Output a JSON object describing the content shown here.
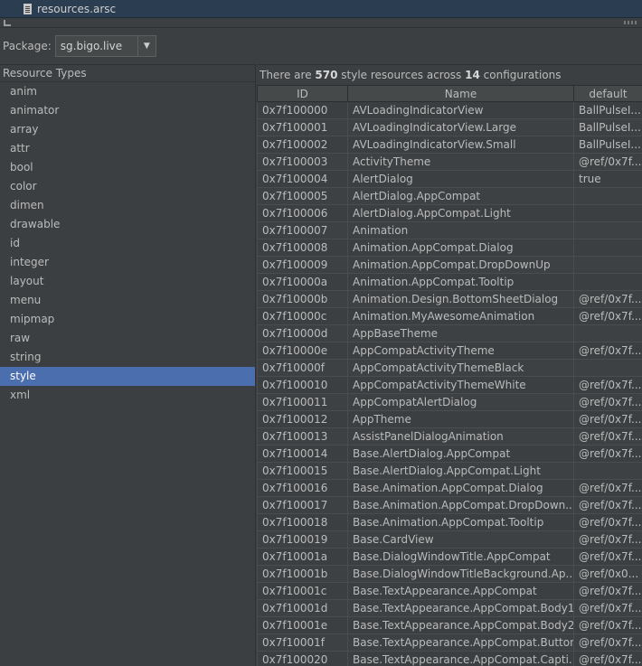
{
  "tab": {
    "title": "resources.arsc",
    "icon": "file-icon"
  },
  "package": {
    "label": "Package:",
    "value": "sg.bigo.live"
  },
  "left": {
    "header": "Resource Types",
    "items": [
      "anim",
      "animator",
      "array",
      "attr",
      "bool",
      "color",
      "dimen",
      "drawable",
      "id",
      "integer",
      "layout",
      "menu",
      "mipmap",
      "raw",
      "string",
      "style",
      "xml"
    ],
    "selected": "style"
  },
  "summary": {
    "prefix": "There are ",
    "count": "570",
    "middle": " style resources across ",
    "configs": "14",
    "suffix": " configurations"
  },
  "table": {
    "columns": [
      "ID",
      "Name",
      "default"
    ],
    "rows": [
      [
        "0x7f100000",
        "AVLoadingIndicatorView",
        "BallPulseI..."
      ],
      [
        "0x7f100001",
        "AVLoadingIndicatorView.Large",
        "BallPulseI..."
      ],
      [
        "0x7f100002",
        "AVLoadingIndicatorView.Small",
        "BallPulseI..."
      ],
      [
        "0x7f100003",
        "ActivityTheme",
        "@ref/0x7f..."
      ],
      [
        "0x7f100004",
        "AlertDialog",
        "true"
      ],
      [
        "0x7f100005",
        "AlertDialog.AppCompat",
        ""
      ],
      [
        "0x7f100006",
        "AlertDialog.AppCompat.Light",
        ""
      ],
      [
        "0x7f100007",
        "Animation",
        ""
      ],
      [
        "0x7f100008",
        "Animation.AppCompat.Dialog",
        ""
      ],
      [
        "0x7f100009",
        "Animation.AppCompat.DropDownUp",
        ""
      ],
      [
        "0x7f10000a",
        "Animation.AppCompat.Tooltip",
        ""
      ],
      [
        "0x7f10000b",
        "Animation.Design.BottomSheetDialog",
        "@ref/0x7f..."
      ],
      [
        "0x7f10000c",
        "Animation.MyAwesomeAnimation",
        "@ref/0x7f..."
      ],
      [
        "0x7f10000d",
        "AppBaseTheme",
        ""
      ],
      [
        "0x7f10000e",
        "AppCompatActivityTheme",
        "@ref/0x7f..."
      ],
      [
        "0x7f10000f",
        "AppCompatActivityThemeBlack",
        ""
      ],
      [
        "0x7f100010",
        "AppCompatActivityThemeWhite",
        "@ref/0x7f..."
      ],
      [
        "0x7f100011",
        "AppCompatAlertDialog",
        "@ref/0x7f..."
      ],
      [
        "0x7f100012",
        "AppTheme",
        "@ref/0x7f..."
      ],
      [
        "0x7f100013",
        "AssistPanelDialogAnimation",
        "@ref/0x7f..."
      ],
      [
        "0x7f100014",
        "Base.AlertDialog.AppCompat",
        "@ref/0x7f..."
      ],
      [
        "0x7f100015",
        "Base.AlertDialog.AppCompat.Light",
        ""
      ],
      [
        "0x7f100016",
        "Base.Animation.AppCompat.Dialog",
        "@ref/0x7f..."
      ],
      [
        "0x7f100017",
        "Base.Animation.AppCompat.DropDown...",
        "@ref/0x7f..."
      ],
      [
        "0x7f100018",
        "Base.Animation.AppCompat.Tooltip",
        "@ref/0x7f..."
      ],
      [
        "0x7f100019",
        "Base.CardView",
        "@ref/0x7f..."
      ],
      [
        "0x7f10001a",
        "Base.DialogWindowTitle.AppCompat",
        "@ref/0x7f..."
      ],
      [
        "0x7f10001b",
        "Base.DialogWindowTitleBackground.Ap...",
        "@ref/0x0..."
      ],
      [
        "0x7f10001c",
        "Base.TextAppearance.AppCompat",
        "@ref/0x7f..."
      ],
      [
        "0x7f10001d",
        "Base.TextAppearance.AppCompat.Body1",
        "@ref/0x7f..."
      ],
      [
        "0x7f10001e",
        "Base.TextAppearance.AppCompat.Body2",
        "@ref/0x7f..."
      ],
      [
        "0x7f10001f",
        "Base.TextAppearance.AppCompat.Button",
        "@ref/0x7f..."
      ],
      [
        "0x7f100020",
        "Base.TextAppearance.AppCompat.Capti...",
        "@ref/0x7f..."
      ]
    ]
  },
  "colors": {
    "selection": "#4b6eaf",
    "background": "#3c3f41",
    "tabbar": "#2b3d50"
  }
}
